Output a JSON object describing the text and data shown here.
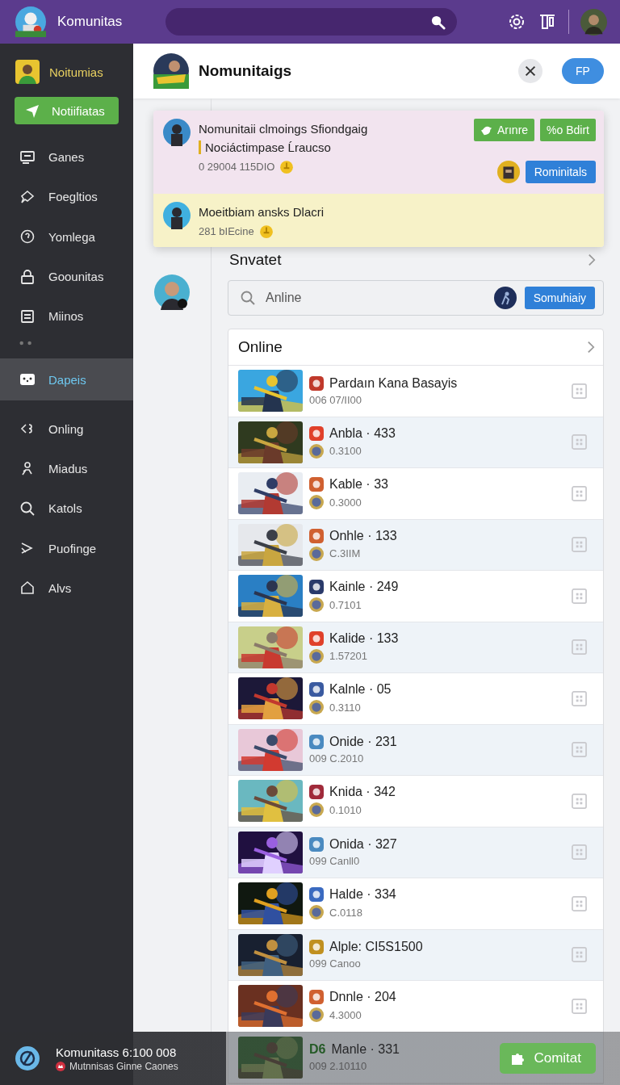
{
  "topbar": {
    "title": "Komunitas"
  },
  "sidebar": {
    "brand": "Noitumias",
    "items": [
      {
        "kind": "button",
        "label": "Notiifiatas"
      },
      {
        "kind": "item",
        "label": "Ganes",
        "selected": false
      },
      {
        "kind": "item",
        "label": "Foegltios",
        "selected": false
      },
      {
        "kind": "item",
        "label": "Yomlega",
        "selected": false
      },
      {
        "kind": "item",
        "label": "Goounitas",
        "selected": false
      },
      {
        "kind": "item",
        "label": "Miinos",
        "selected": false
      },
      {
        "kind": "divider"
      },
      {
        "kind": "item",
        "label": "Dapeis",
        "selected": true
      },
      {
        "kind": "item",
        "label": "Onling",
        "selected": false
      },
      {
        "kind": "item",
        "label": "Miadus",
        "selected": false
      },
      {
        "kind": "item",
        "label": "Katols",
        "selected": false
      },
      {
        "kind": "item",
        "label": "Puofinge",
        "selected": false
      },
      {
        "kind": "item",
        "label": "Alvs",
        "selected": false
      }
    ]
  },
  "header": {
    "title": "Nomunitaigs",
    "button": "FP"
  },
  "notifications": [
    {
      "kind": "pink",
      "title": "Nomunitaii clmoings Sfiondgaig",
      "line": "Nociáctimpase Ĺraucso",
      "meta": "0 29004 115DIO",
      "actions": [
        "Arınre",
        "%o Bdirt"
      ],
      "button": "Rominitals"
    },
    {
      "kind": "yellow",
      "title": "Moeitbiam  ansks Dlacri",
      "meta": "281  bIEcine"
    }
  ],
  "section": {
    "title": "Snvatet",
    "search": {
      "placeholder": "Anline"
    },
    "button": "Somuhiaiy"
  },
  "list": {
    "title": "Online",
    "rows": [
      {
        "title": "Pardaın Kana Basayis",
        "subtitle": "006 07/II00",
        "sub_icon": false
      },
      {
        "title": "Anbla · 433",
        "subtitle": "0.3100",
        "sub_icon": true
      },
      {
        "title": "Kable · 33",
        "subtitle": "0.3000",
        "sub_icon": true
      },
      {
        "title": "Onhle · 133",
        "subtitle": "C.3IIM",
        "sub_icon": true
      },
      {
        "title": "Kainle · 249",
        "subtitle": "0.7101",
        "sub_icon": true
      },
      {
        "title": "Kalide · 133",
        "subtitle": "1.57201",
        "sub_icon": true
      },
      {
        "title": "Kalnle · 05",
        "subtitle": "0.3110",
        "sub_icon": true
      },
      {
        "title": "Onide · 231",
        "subtitle": "009 C.2010",
        "sub_icon": false
      },
      {
        "title": "Knida · 342",
        "subtitle": "0.1010",
        "sub_icon": true
      },
      {
        "title": "Onida · 327",
        "subtitle": "099 Canll0",
        "sub_icon": false
      },
      {
        "title": "Halde · 334",
        "subtitle": "C.0118",
        "sub_icon": true
      },
      {
        "title": "Alple: CI5S1500",
        "subtitle": "099 Canoo",
        "sub_icon": false
      },
      {
        "title": "Dnnle · 204",
        "subtitle": "4.3000",
        "sub_icon": true
      },
      {
        "title": "Manle · 331",
        "subtitle": "009 2.10110",
        "sub_icon": false,
        "badge": "D6"
      }
    ]
  },
  "footer": {
    "title": "Komunitass 6:100 008",
    "subtitle": "Mutnnisas Ginne Caones",
    "button": "Comitat"
  }
}
